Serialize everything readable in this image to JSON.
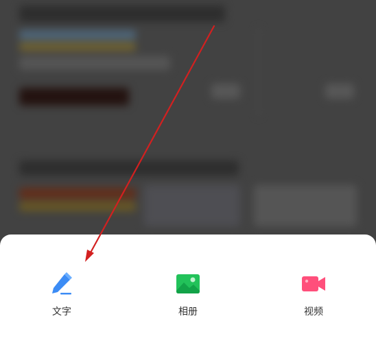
{
  "sheet": {
    "actions": [
      {
        "label": "文字",
        "icon": "pen-icon",
        "color": "#3C8CF5"
      },
      {
        "label": "相册",
        "icon": "image-icon",
        "color": "#22C25A"
      },
      {
        "label": "视频",
        "icon": "video-camera-icon",
        "color": "#FF4F7B"
      }
    ]
  },
  "annotation": {
    "arrow_color": "#D32020"
  }
}
